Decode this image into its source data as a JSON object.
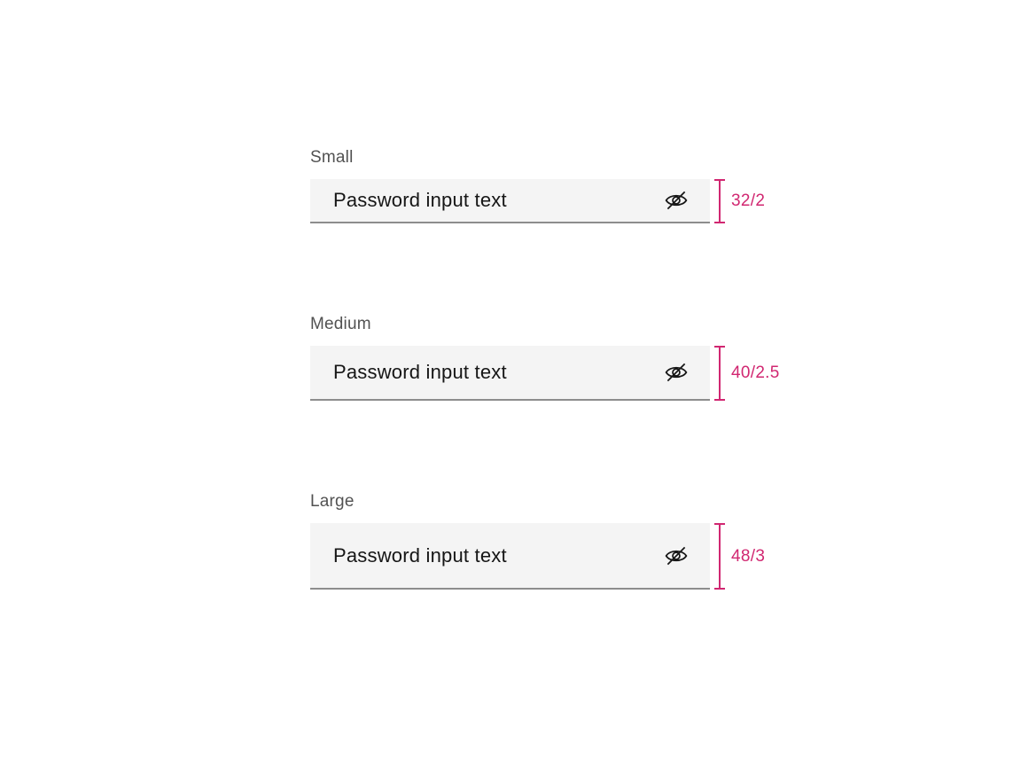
{
  "variants": [
    {
      "label": "Small",
      "value": "Password input text",
      "spec": "32/2",
      "icon": "eye-off-icon"
    },
    {
      "label": "Medium",
      "value": "Password input text",
      "spec": "40/2.5",
      "icon": "eye-off-icon"
    },
    {
      "label": "Large",
      "value": "Password input text",
      "spec": "48/3",
      "icon": "eye-off-icon"
    }
  ],
  "colors": {
    "field_background": "#f4f4f4",
    "field_border": "#8d8d8d",
    "label": "#525252",
    "text": "#161616",
    "annotation": "#d12771"
  }
}
